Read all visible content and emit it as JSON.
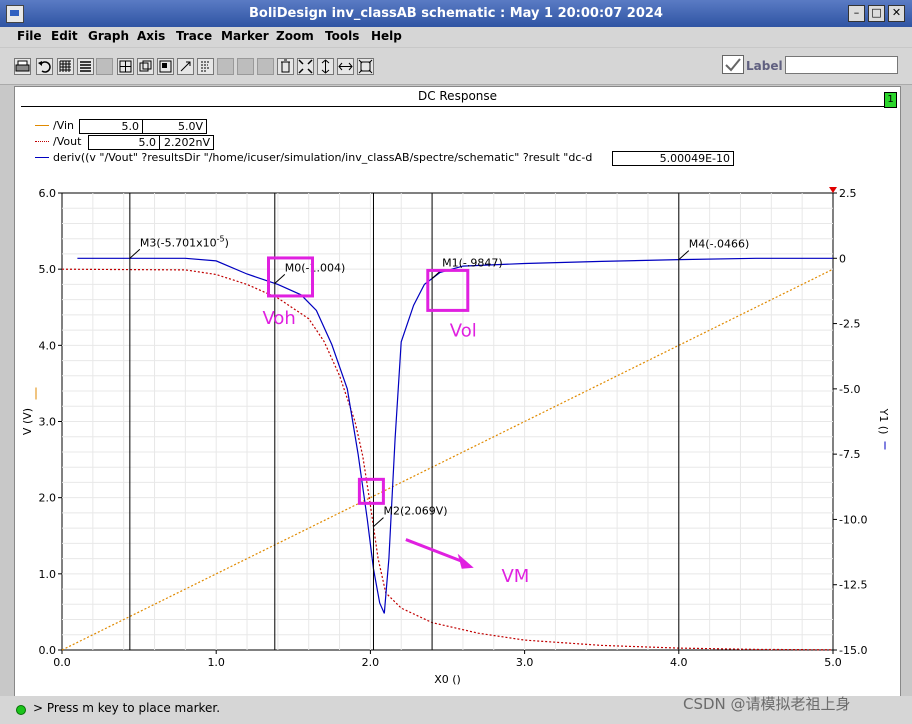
{
  "window": {
    "title": "BoliDesign inv_classAB schematic : May  1 20:00:07 2024",
    "controls": [
      "–",
      "□",
      "✕"
    ]
  },
  "menu": [
    "File",
    "Edit",
    "Graph",
    "Axis",
    "Trace",
    "Marker",
    "Zoom",
    "Tools",
    "Help"
  ],
  "toolbar": {
    "icons": [
      "print-icon",
      "undo-icon",
      "grid-icon",
      "list-icon",
      "frame-icon",
      "split-icon",
      "overlay-icon",
      "stack-icon",
      "cascade-icon",
      "tag-icon",
      "strip-icon",
      "strip2-icon",
      "table-icon",
      "delete-icon",
      "fit-icon",
      "zoom-x-icon",
      "zoom-y-icon",
      "zoom-box-icon"
    ],
    "label_text": "Label",
    "label_value": ""
  },
  "graph": {
    "title": "DC Response",
    "page_badge": "1",
    "legend": [
      {
        "name": "/Vin",
        "v1": "5.0",
        "v2": "5.0V",
        "color": "#e08a00"
      },
      {
        "name": "/Vout",
        "v1": "5.0",
        "v2": "2.202nV",
        "color": "#c00000"
      },
      {
        "name": "deriv((v \"/Vout\" ?resultsDir \"/home/icuser/simulation/inv_classAB/spectre/schematic\" ?result \"dc-d",
        "v1": "5.00049E-10",
        "color": "#0000c0"
      }
    ]
  },
  "chart_data": {
    "type": "line",
    "xlabel": "X0 ()",
    "ylabel": "V (V)",
    "y2label": "Y1 ()",
    "xlim": [
      0,
      5
    ],
    "ylim": [
      0,
      6
    ],
    "y2lim": [
      -15,
      2.5
    ],
    "x_ticks": [
      "0.0",
      "1.0",
      "2.0",
      "3.0",
      "4.0",
      "5.0"
    ],
    "y_ticks": [
      "0.0",
      "1.0",
      "2.0",
      "3.0",
      "4.0",
      "5.0",
      "6.0"
    ],
    "y2_ticks": [
      "-15.0",
      "-12.5",
      "-10.0",
      "-7.5",
      "-5.0",
      "-2.5",
      "0",
      "2.5"
    ],
    "series": [
      {
        "name": "/Vin",
        "axis": "left",
        "color": "#e08a00",
        "x": [
          0,
          5
        ],
        "y": [
          0,
          5
        ]
      },
      {
        "name": "/Vout",
        "axis": "left",
        "color": "#c00000",
        "x": [
          0,
          0.8,
          1.0,
          1.2,
          1.4,
          1.6,
          1.7,
          1.8,
          1.9,
          1.95,
          2.0,
          2.05,
          2.1,
          2.2,
          2.4,
          2.7,
          3.0,
          3.5,
          4.0,
          4.5,
          5.0
        ],
        "y": [
          5.0,
          4.99,
          4.93,
          4.8,
          4.62,
          4.35,
          4.05,
          3.6,
          3.0,
          2.55,
          1.9,
          1.2,
          0.75,
          0.55,
          0.36,
          0.22,
          0.13,
          0.06,
          0.025,
          0.008,
          0.002
        ]
      },
      {
        "name": "deriv",
        "axis": "right",
        "color": "#0000c0",
        "x": [
          0.1,
          0.8,
          1.0,
          1.2,
          1.4,
          1.55,
          1.65,
          1.75,
          1.85,
          1.92,
          1.98,
          2.02,
          2.06,
          2.09,
          2.12,
          2.16,
          2.2,
          2.28,
          2.35,
          2.45,
          2.6,
          3.0,
          3.5,
          4.0,
          4.5,
          5.0
        ],
        "y": [
          0,
          0,
          -0.1,
          -0.6,
          -1.0,
          -1.4,
          -2.0,
          -3.3,
          -5.0,
          -7.5,
          -10.0,
          -11.9,
          -13.2,
          -13.6,
          -11.5,
          -6.9,
          -3.2,
          -1.8,
          -1.0,
          -0.55,
          -0.3,
          -0.2,
          -0.12,
          -0.05,
          0,
          0
        ]
      }
    ],
    "markers": [
      {
        "label": "M3(-5.701x10",
        "sup": "-5",
        "tail": ")",
        "x": 0.44
      },
      {
        "label": "M0(-1.004)",
        "x": 1.38
      },
      {
        "label": "M2(2.069V)",
        "x": 2.02
      },
      {
        "label": "M1(-.9847)",
        "x": 2.4
      },
      {
        "label": "M4(-.0466)",
        "x": 4.0
      }
    ],
    "annotations": [
      "Voh",
      "Vol",
      "VM"
    ]
  },
  "status": {
    "text": "> Press m key to place marker."
  },
  "watermark": "CSDN @请模拟老祖上身"
}
